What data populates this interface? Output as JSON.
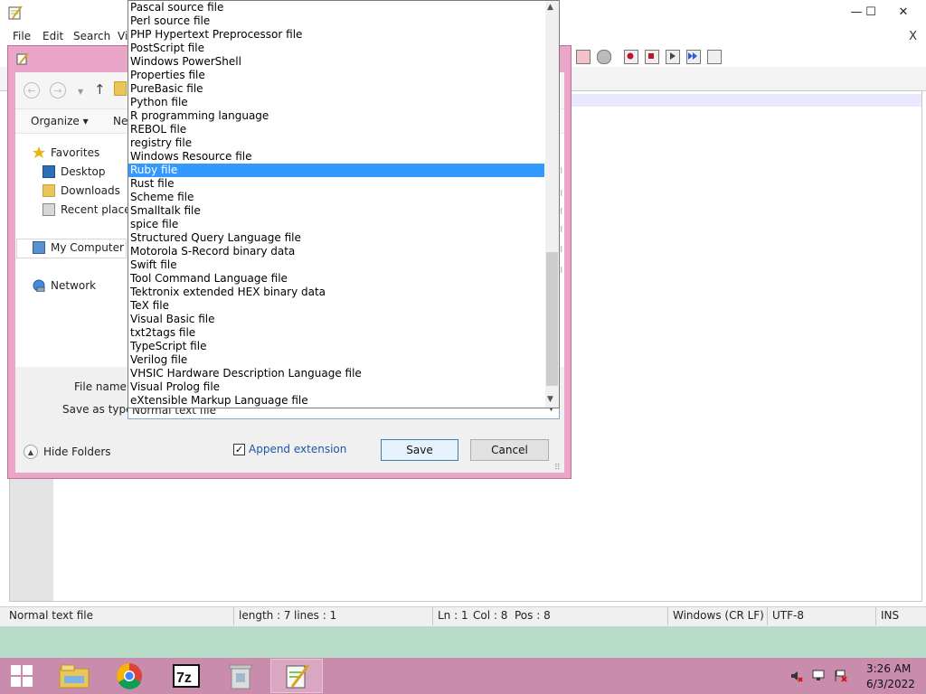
{
  "main_window": {
    "menu": [
      "File",
      "Edit",
      "Search",
      "Vi"
    ],
    "controls": {
      "minimize": "—",
      "maximize": "☐",
      "close": "✕"
    },
    "close_doc": "X"
  },
  "status_bar": {
    "file_type": "Normal text file",
    "length": "length : 7",
    "lines": "lines : 1",
    "ln": "Ln : 1",
    "col": "Col : 8",
    "pos": "Pos : 8",
    "eol": "Windows (CR LF)",
    "encoding": "UTF-8",
    "mode": "INS"
  },
  "save_dialog": {
    "organize": "Organize ▾",
    "new_folder": "Ne",
    "nav": {
      "favorites": "Favorites",
      "desktop": "Desktop",
      "downloads": "Downloads",
      "recent": "Recent places",
      "my_computer": "My Computer",
      "network": "Network"
    },
    "file_name_label": "File name:",
    "save_as_type_label": "Save as type:",
    "save_as_type_value": "Normal text file",
    "hide_folders": "Hide Folders",
    "append_extension": "Append extension",
    "append_checked": "✓",
    "save": "Save",
    "cancel": "Cancel"
  },
  "type_dropdown": {
    "items": [
      "Pascal source file",
      "Perl source file",
      "PHP Hypertext Preprocessor file",
      "PostScript file",
      "Windows PowerShell",
      "Properties file",
      "PureBasic file",
      "Python file",
      "R programming language",
      "REBOL file",
      "registry file",
      "Windows Resource file",
      "Ruby file",
      "Rust file",
      "Scheme file",
      "Smalltalk file",
      "spice file",
      "Structured Query Language file",
      "Motorola S-Record binary data",
      "Swift file",
      "Tool Command Language file",
      "Tektronix extended HEX binary data",
      "TeX file",
      "Visual Basic file",
      "txt2tags file",
      "TypeScript file",
      "Verilog file",
      "VHSIC Hardware Description Language file",
      "Visual Prolog file",
      "eXtensible Markup Language file"
    ],
    "selected": "Ruby file"
  },
  "taskbar": {
    "time": "3:26 AM",
    "date": "6/3/2022",
    "apps": [
      "file-explorer",
      "chrome",
      "7-zip",
      "recycle-bin",
      "notepad-plus-plus"
    ]
  },
  "colors": {
    "accent_pink": "#c98cad",
    "dialog_frame": "#e9a6c9",
    "selection_blue": "#3399ff"
  }
}
